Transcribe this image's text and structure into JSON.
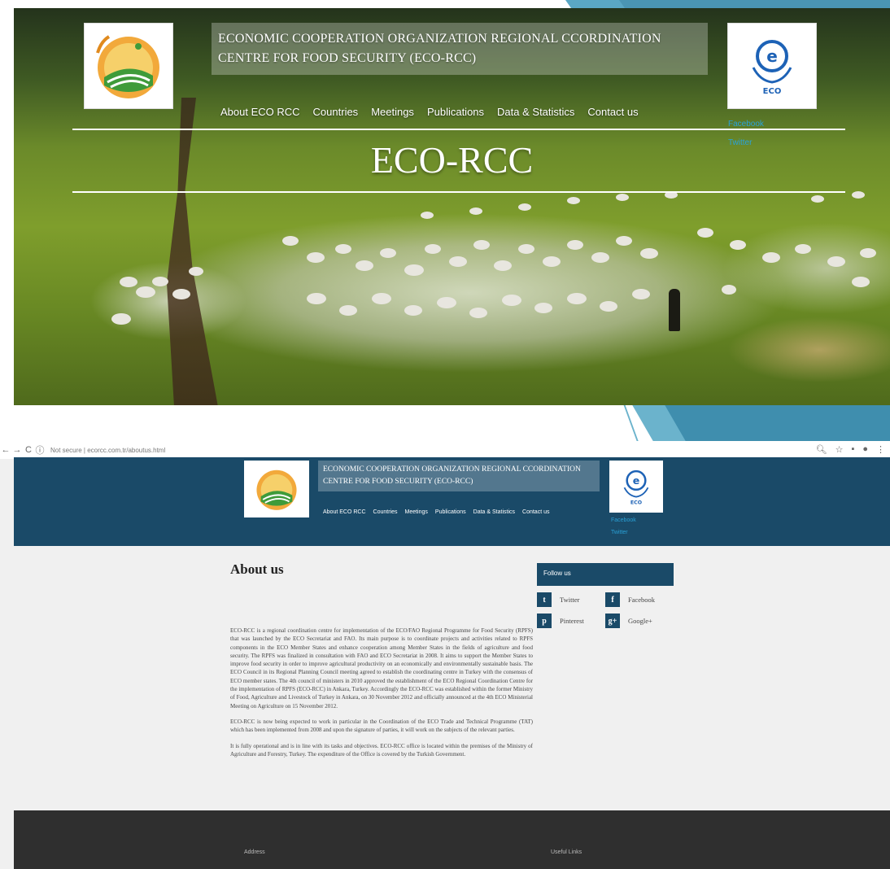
{
  "hero": {
    "title_line1": "ECONOMIC COOPERATION ORGANIZATION REGIONAL CCORDINATION",
    "title_line2": "CENTRE FOR FOOD SECURITY (ECO-RCC)",
    "heading": "ECO-RCC",
    "nav": [
      "About ECO RCC",
      "Countries",
      "Meetings",
      "Publications",
      "Data & Statistics",
      "Contact us"
    ],
    "social": [
      "Facebook",
      "Twitter"
    ],
    "eco_logo_text": "ECO"
  },
  "browser": {
    "url": "Not secure | ecorcc.com.tr/aboutus.html",
    "title_line1": "ECONOMIC COOPERATION ORGANIZATION REGIONAL CCORDINATION",
    "title_line2": "CENTRE FOR FOOD SECURITY (ECO-RCC)",
    "nav": [
      "About ECO RCC",
      "Countries",
      "Meetings",
      "Publications",
      "Data & Statistics",
      "Contact us"
    ],
    "social": [
      "Facebook",
      "Twitter"
    ],
    "eco_logo_text": "ECO"
  },
  "about": {
    "heading": "About us",
    "paragraphs": [
      "ECO-RCC is a regional coordination centre for implementation of the ECO/FAO Regional Programme for Food Security (RPFS) that was launched by the ECO Secretariat and FAO. Its main purpose is to coordinate projects and activities related to RPFS components in the ECO Member States and enhance cooperation among Member States in the fields of agriculture and food security. The RPFS was finalized in consultation with FAO and ECO Secretariat in 2008. It aims to support the Member States to improve food security in order to improve agricultural productivity on an economically and environmentally sustainable basis. The ECO Council in its Regional Planning Council meeting agreed to establish the coordinating centre in Turkey with the consensus of ECO member states. The 4th council of ministers in 2010 approved the establishment of the ECO Regional Coordination Centre for the implementation of RPFS (ECO-RCC) in Ankara, Turkey. Accordingly the ECO-RCC was established within the former Ministry of Food, Agriculture and Livestock of Turkey in Ankara, on 30 November 2012 and officially announced at the 4th ECO Ministerial Meeting on Agriculture on 15 November 2012.",
      "ECO-RCC is now being expected to work in particular in the Coordination of the ECO Trade and Technical Programme (TAT) which has been implemented from 2008 and upon the signature of parties, it will work on the subjects of the relevant parties.",
      "It is fully operational and is in line with its tasks and objectives. ECO-RCC office is located within the premises of the Ministry of Agriculture and Forestry, Turkey. The expenditure of the Office is covered by the Turkish Government."
    ]
  },
  "sidebar": {
    "heading": "Follow us",
    "items": [
      {
        "label": "Twitter",
        "icon": "twitter-icon",
        "glyph": "t"
      },
      {
        "label": "Facebook",
        "icon": "facebook-icon",
        "glyph": "f"
      },
      {
        "label": "Pinterest",
        "icon": "pinterest-icon",
        "glyph": "p"
      },
      {
        "label": "Google+",
        "icon": "google-plus-icon",
        "glyph": "g+"
      }
    ]
  },
  "footer": {
    "address_label": "Address",
    "links_label": "Useful Links"
  },
  "colors": {
    "header_bg": "#1a4a68",
    "link": "#29a0d6",
    "footer_bg": "#2f2f2f"
  }
}
